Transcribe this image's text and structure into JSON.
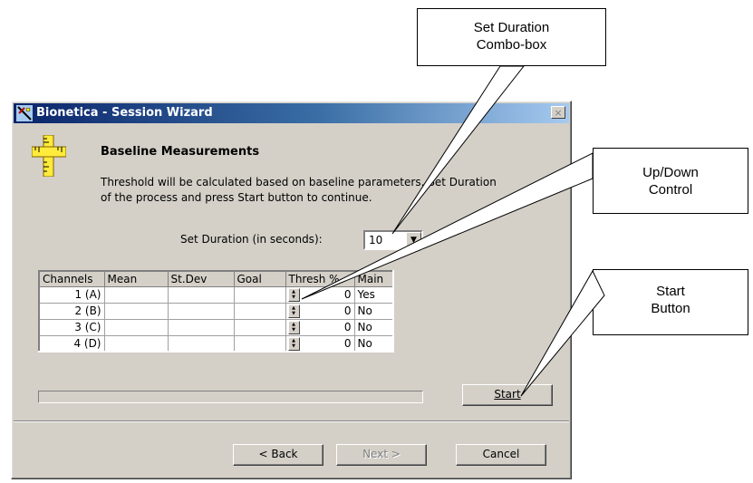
{
  "window": {
    "title": "Bionetica - Session Wizard",
    "close_glyph": "×"
  },
  "wizard": {
    "heading": "Baseline Measurements",
    "description_line1": "Threshold will be calculated based on baseline parameters. Set Duration",
    "description_line2": "of the process and press Start button to continue."
  },
  "duration": {
    "label": "Set Duration (in seconds):",
    "value": "10",
    "arrow": "▼"
  },
  "grid": {
    "headers": [
      "Channels",
      "Mean",
      "St.Dev",
      "Goal",
      "Thresh %",
      "Main"
    ],
    "rows": [
      {
        "channel": "1 (A)",
        "mean": "",
        "stdev": "",
        "goal": "",
        "thresh": "0",
        "main": "Yes"
      },
      {
        "channel": "2 (B)",
        "mean": "",
        "stdev": "",
        "goal": "",
        "thresh": "0",
        "main": "No"
      },
      {
        "channel": "3 (C)",
        "mean": "",
        "stdev": "",
        "goal": "",
        "thresh": "0",
        "main": "No"
      },
      {
        "channel": "4 (D)",
        "mean": "",
        "stdev": "",
        "goal": "",
        "thresh": "0",
        "main": "No"
      }
    ]
  },
  "progress": {
    "value": 0
  },
  "buttons": {
    "start": "Start",
    "back": "< Back",
    "next": "Next >",
    "cancel": "Cancel"
  },
  "callouts": {
    "duration_line1": "Set Duration",
    "duration_line2": "Combo-box",
    "updown_line1": "Up/Down",
    "updown_line2": "Control",
    "start_line1": "Start",
    "start_line2": "Button"
  },
  "colors": {
    "titlebar_start": "#0a246a",
    "titlebar_end": "#a6caf0",
    "dialog_face": "#d4d0c8"
  },
  "icons": {
    "app": "bionetica-app-icon",
    "wizard": "ruler-cross-icon",
    "spinner": "up-down-spinner-icon"
  }
}
